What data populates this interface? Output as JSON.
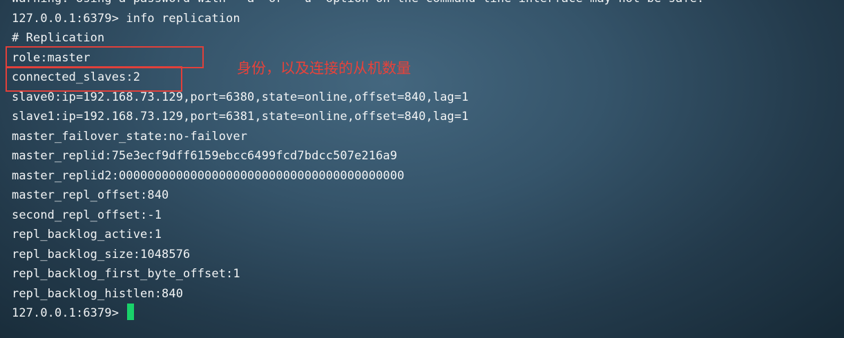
{
  "terminal": {
    "lines": [
      "Warning: Using a password with '-a' or '-u' option on the command line interface may not be safe.",
      "127.0.0.1:6379> info replication",
      "# Replication",
      "role:master",
      "connected_slaves:2",
      "slave0:ip=192.168.73.129,port=6380,state=online,offset=840,lag=1",
      "slave1:ip=192.168.73.129,port=6381,state=online,offset=840,lag=1",
      "master_failover_state:no-failover",
      "master_replid:75e3ecf9dff6159ebcc6499fcd7bdcc507e216a9",
      "master_replid2:0000000000000000000000000000000000000000",
      "master_repl_offset:840",
      "second_repl_offset:-1",
      "repl_backlog_active:1",
      "repl_backlog_size:1048576",
      "repl_backlog_first_byte_offset:1",
      "repl_backlog_histlen:840"
    ],
    "prompt": "127.0.0.1:6379> "
  },
  "annotation": {
    "text": "身份，以及连接的从机数量"
  },
  "colors": {
    "text": "#f2f4f5",
    "cursor": "#19d26a",
    "highlight": "#e2403a"
  }
}
